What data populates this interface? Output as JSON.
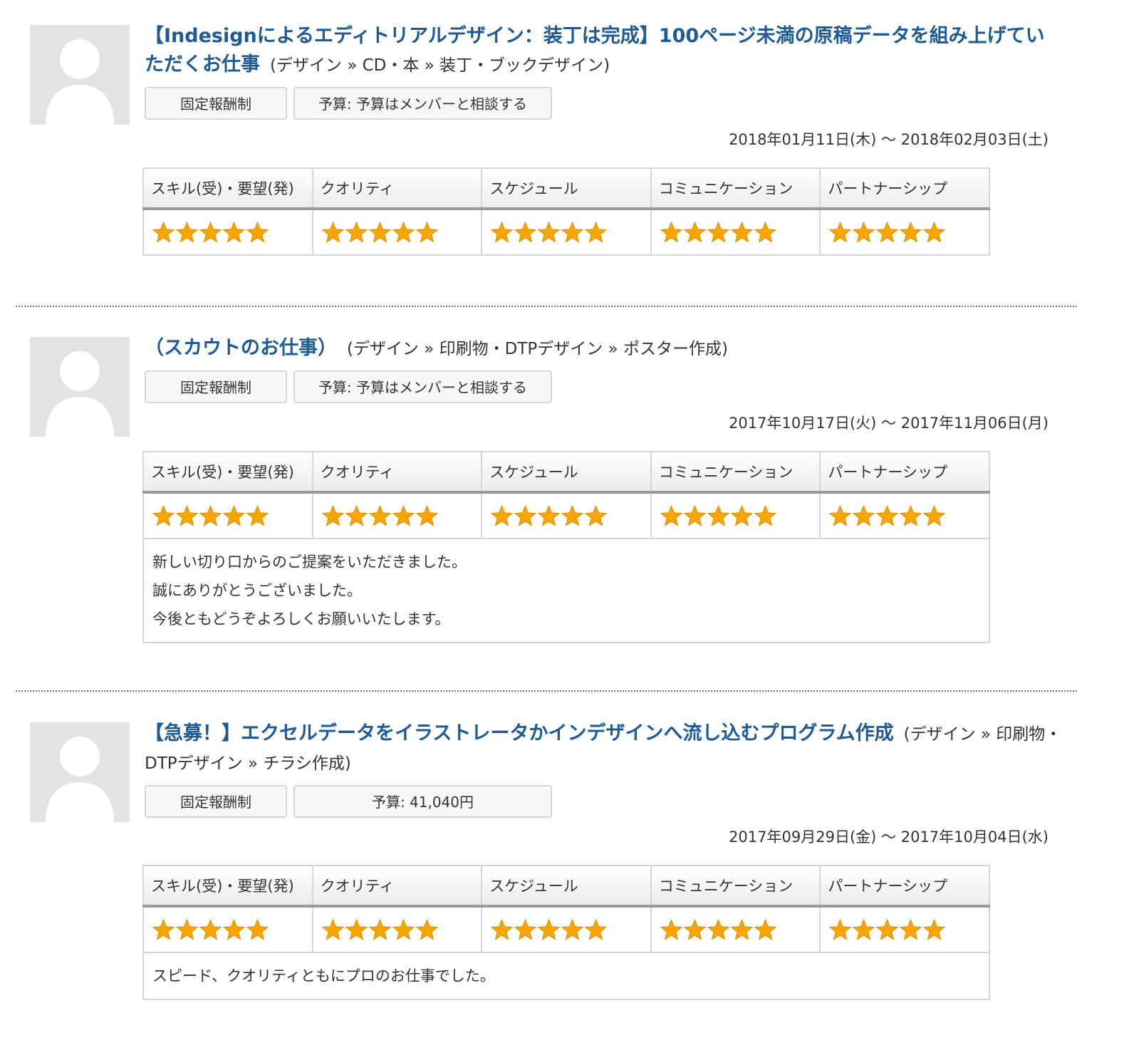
{
  "labels": {
    "pay_type": "固定報酬制",
    "criteria": [
      "スキル(受)・要望(発)",
      "クオリティ",
      "スケジュール",
      "コミュニケーション",
      "パートナーシップ"
    ],
    "date_separator": "〜"
  },
  "entries": [
    {
      "avatar_icon": "default-user-avatar-icon",
      "title": "【Indesignによるエディトリアルデザイン：装丁は完成】100ページ未満の原稿データを組み上げていただくお仕事",
      "category": "(デザイン » CD・本 » 装丁・ブックデザイン)",
      "budget": "予算: 予算はメンバーと相談する",
      "date_start": "2018年01月11日(木)",
      "date_end": "2018年02月03日(土)",
      "ratings": [
        5,
        5,
        5,
        5,
        5
      ],
      "comment": []
    },
    {
      "avatar_icon": "default-user-avatar-icon",
      "title": "（スカウトのお仕事）",
      "category": "(デザイン » 印刷物・DTPデザイン » ポスター作成)",
      "budget": "予算: 予算はメンバーと相談する",
      "date_start": "2017年10月17日(火)",
      "date_end": "2017年11月06日(月)",
      "ratings": [
        5,
        5,
        5,
        5,
        5
      ],
      "comment": [
        "新しい切り口からのご提案をいただきました。",
        "誠にありがとうございました。",
        "今後ともどうぞよろしくお願いいたします。"
      ]
    },
    {
      "avatar_icon": "default-user-avatar-icon",
      "title": "【急募！】エクセルデータをイラストレータかインデザインへ流し込むプログラム作成",
      "category": "(デザイン » 印刷物・DTPデザイン » チラシ作成)",
      "budget": "予算: 41,040円",
      "date_start": "2017年09月29日(金)",
      "date_end": "2017年10月04日(水)",
      "ratings": [
        5,
        5,
        5,
        5,
        5
      ],
      "comment": [
        "スピード、クオリティともにプロのお仕事でした。"
      ]
    }
  ],
  "colors": {
    "title_link": "#1d5a96",
    "star": "#f7a600",
    "avatar_bg": "#e3e3e3"
  }
}
